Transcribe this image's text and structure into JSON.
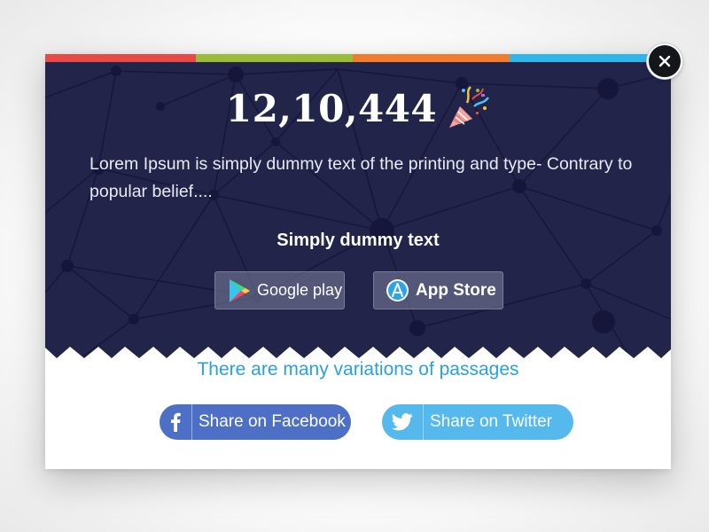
{
  "popup": {
    "color_bar": [
      "#e74949",
      "#9bbb3a",
      "#f07d2f",
      "#2fb5ea"
    ],
    "counter": "12,10,444",
    "counter_icon": "party-popper-icon",
    "description": "Lorem Ipsum is simply dummy text of the printing and type- Contrary to popular belief....",
    "subtitle": "Simply dummy text",
    "stores": {
      "google": {
        "label": "Google play",
        "icon": "google-play-icon"
      },
      "apple": {
        "label": "App Store",
        "icon": "app-store-icon"
      }
    },
    "variations_text": "There are many variations of passages",
    "share": {
      "facebook": {
        "label": "Share on Facebook",
        "icon": "facebook-icon",
        "color": "#4e6fc6"
      },
      "twitter": {
        "label": "Share on Twitter",
        "icon": "twitter-icon",
        "color": "#55b9ed"
      }
    },
    "close_icon": "close-icon",
    "hero_bg": "#22244a",
    "accent": "#2aa0e4"
  }
}
